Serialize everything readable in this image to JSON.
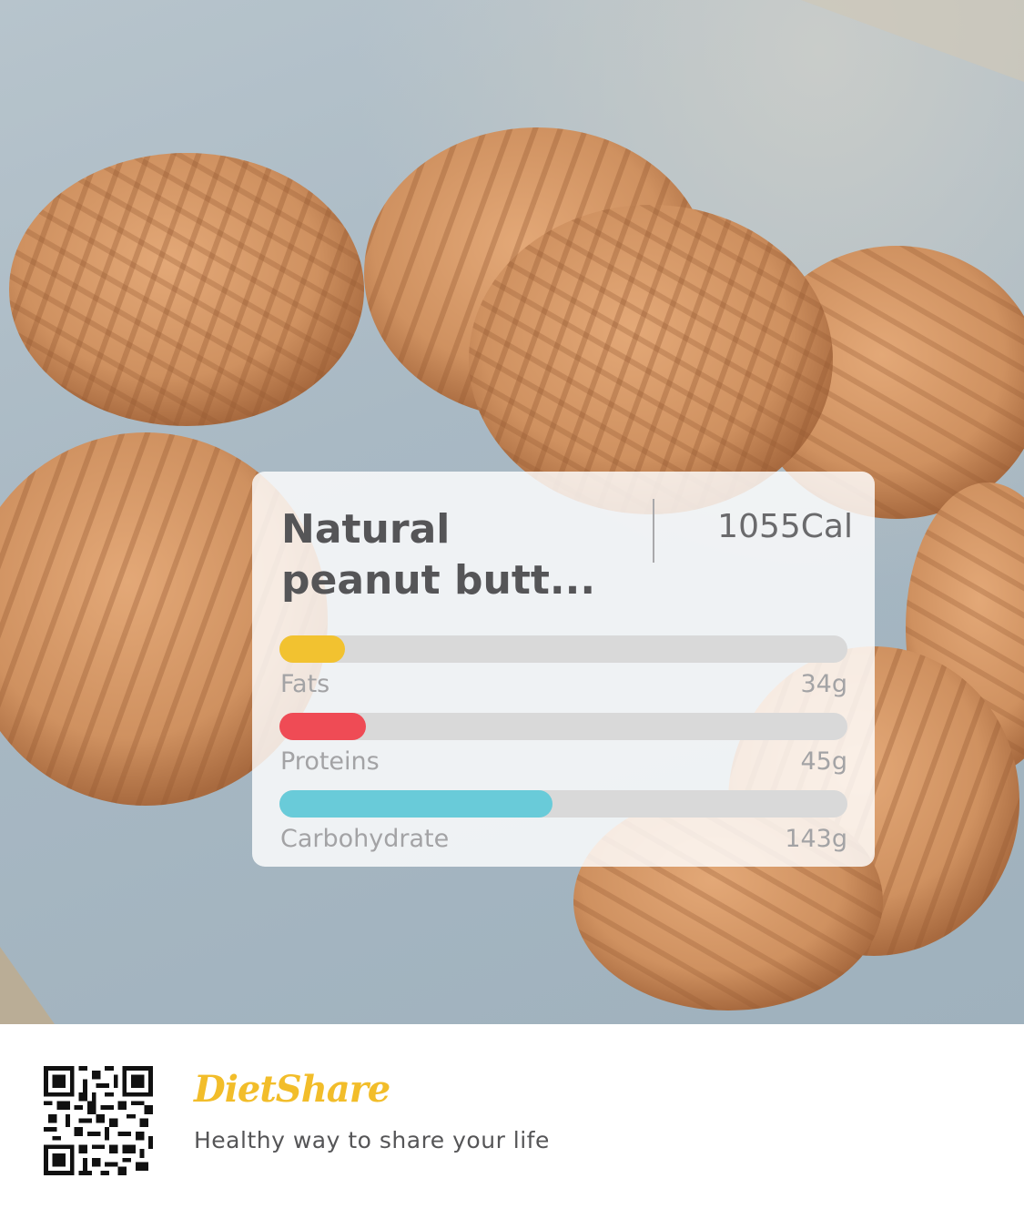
{
  "food": {
    "name_line1": "Natural",
    "name_line2": "peanut butt...",
    "calories": "1055Cal"
  },
  "nutrients": [
    {
      "label": "Fats",
      "value": "34g",
      "fill_fraction": 0.115,
      "color": "#f2c230"
    },
    {
      "label": "Proteins",
      "value": "45g",
      "fill_fraction": 0.152,
      "color": "#ef4b55"
    },
    {
      "label": "Carbohydrate",
      "value": "143g",
      "fill_fraction": 0.48,
      "color": "#69cbd9"
    }
  ],
  "footer": {
    "brand": "DietShare",
    "tagline": "Healthy way to share your life",
    "qr_icon": "qr-code-icon"
  },
  "colors": {
    "track": "#d9d9d9",
    "brand": "#f2bd2a"
  }
}
